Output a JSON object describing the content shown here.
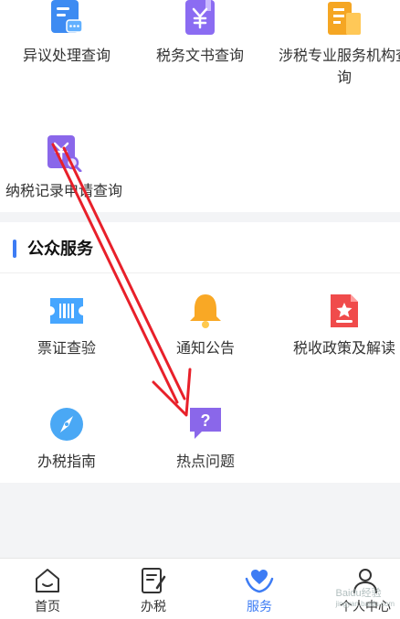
{
  "top_services": {
    "items": [
      {
        "label": "异议处理查询",
        "icon": "document-chat-icon"
      },
      {
        "label": "税务文书查询",
        "icon": "yuan-document-icon"
      },
      {
        "label": "涉税专业服务机构查询",
        "icon": "building-icon"
      },
      {
        "label": "纳税记录申请查询",
        "icon": "record-search-icon"
      }
    ]
  },
  "public_services": {
    "title": "公众服务",
    "items": [
      {
        "label": "票证查验",
        "icon": "ticket-icon"
      },
      {
        "label": "通知公告",
        "icon": "bell-icon"
      },
      {
        "label": "税收政策及解读",
        "icon": "policy-document-icon"
      },
      {
        "label": "办税指南",
        "icon": "compass-icon"
      },
      {
        "label": "热点问题",
        "icon": "question-bubble-icon"
      }
    ]
  },
  "tabbar": {
    "tabs": [
      {
        "label": "首页",
        "icon": "home-icon"
      },
      {
        "label": "办税",
        "icon": "edit-icon"
      },
      {
        "label": "服务",
        "icon": "heart-hands-icon",
        "active": true
      },
      {
        "label": "个人中心",
        "icon": "person-icon"
      }
    ]
  },
  "watermark": {
    "text": "Baidu经验",
    "url": "jingyan.baidu.com"
  },
  "colors": {
    "accent": "#3d7cf4",
    "annotation_arrow": "#e8202a"
  }
}
